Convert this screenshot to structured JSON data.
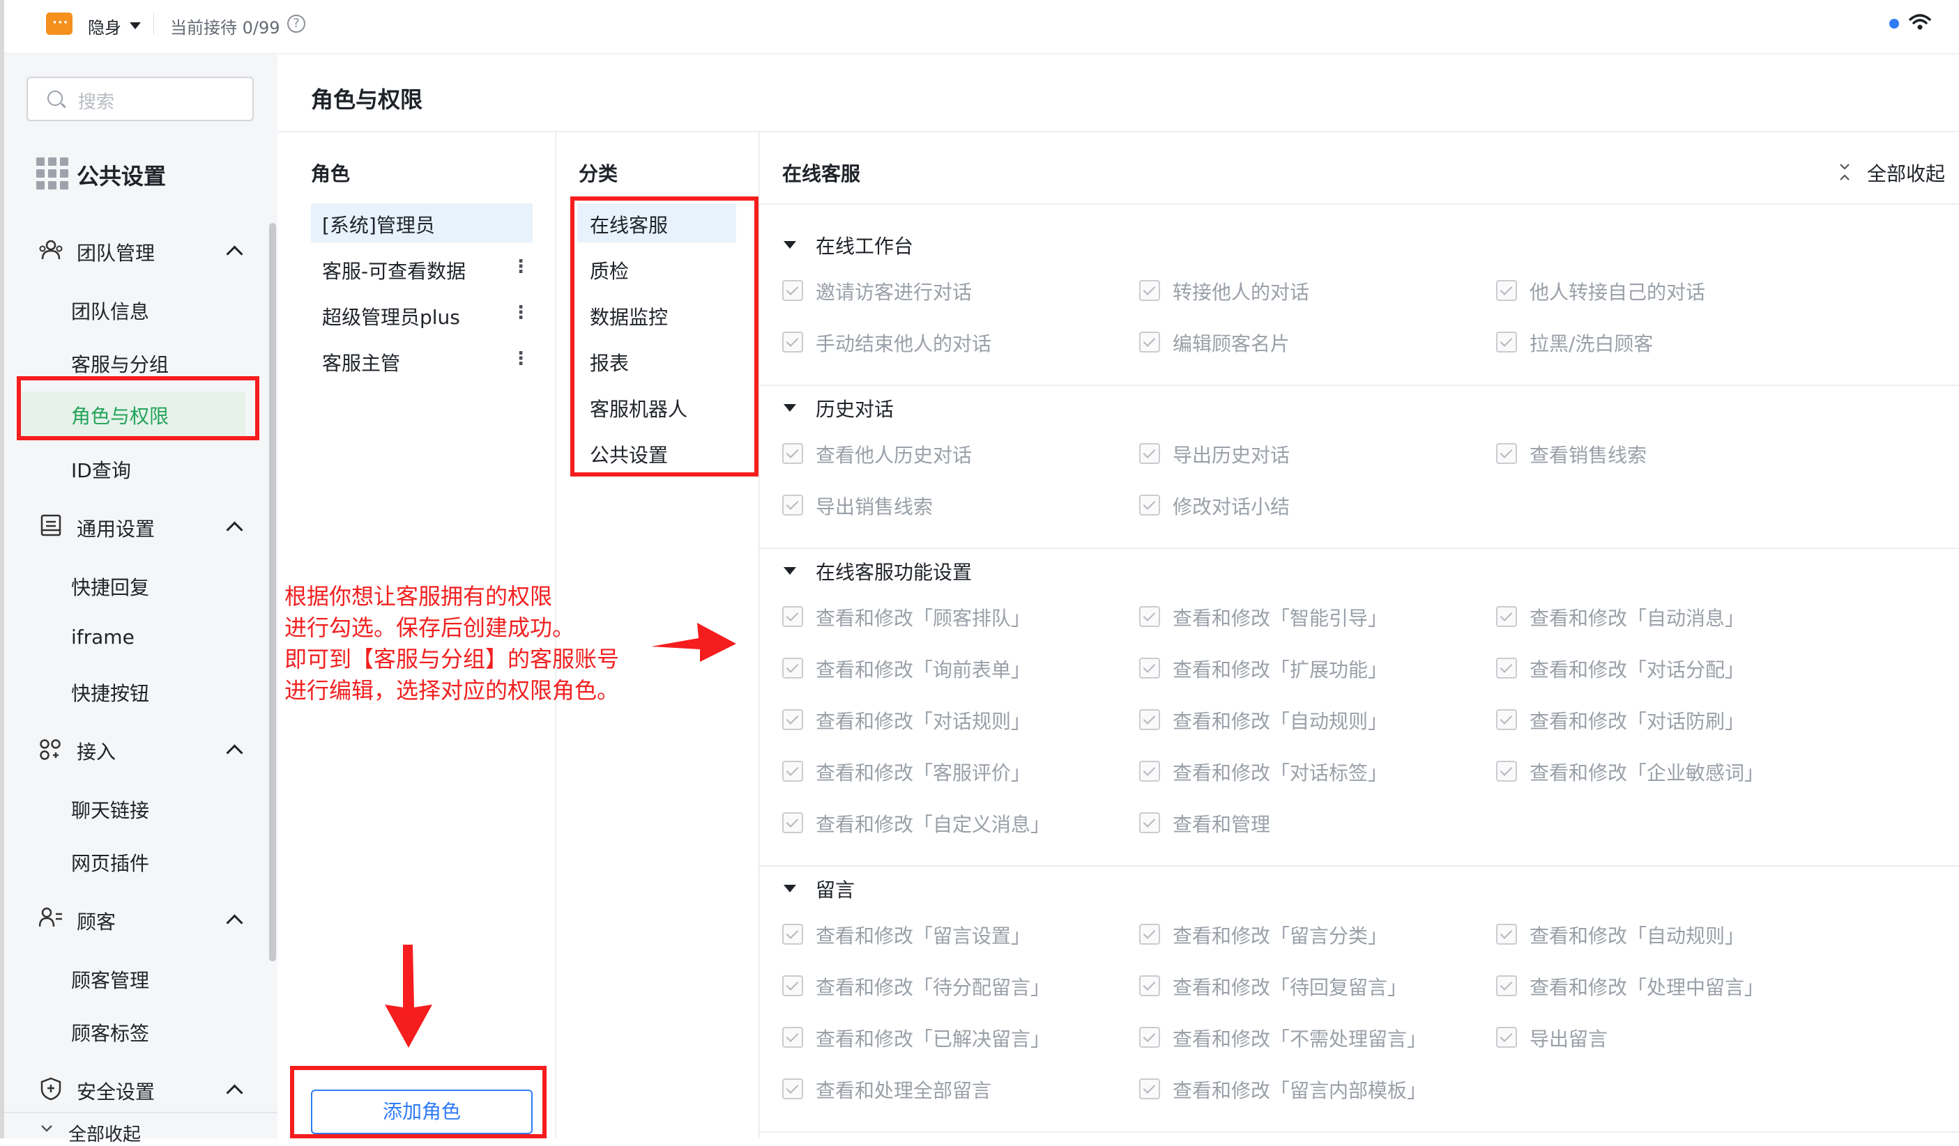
{
  "topbar": {
    "status": "隐身",
    "current_reception": "当前接待 0/99",
    "help": "?"
  },
  "sidebar": {
    "search_placeholder": "搜索",
    "title": "公共设置",
    "groups": [
      {
        "label": "团队管理",
        "icon": "team-icon",
        "items": [
          "团队信息",
          "客服与分组",
          "角色与权限",
          "ID查询"
        ]
      },
      {
        "label": "通用设置",
        "icon": "settings-list-icon",
        "items": [
          "快捷回复",
          "iframe",
          "快捷按钮"
        ]
      },
      {
        "label": "接入",
        "icon": "access-icon",
        "items": [
          "聊天链接",
          "网页插件"
        ]
      },
      {
        "label": "顾客",
        "icon": "customer-icon",
        "items": [
          "顾客管理",
          "顾客标签"
        ]
      },
      {
        "label": "安全设置",
        "icon": "shield-icon",
        "items": []
      }
    ],
    "collapse_all": "全部收起"
  },
  "main": {
    "title": "角色与权限",
    "roles_header": "角色",
    "roles": [
      "[系统]管理员",
      "客服-可查看数据",
      "超级管理员plus",
      "客服主管"
    ],
    "add_role": "添加角色",
    "categories_header": "分类",
    "categories": [
      "在线客服",
      "质检",
      "数据监控",
      "报表",
      "客服机器人",
      "公共设置"
    ],
    "perm_header": "在线客服",
    "collapse_all": "全部收起"
  },
  "annotation": {
    "lines": [
      "根据你想让客服拥有的权限",
      "进行勾选。保存后创建成功。",
      "即可到【客服与分组】的客服账号",
      "进行编辑，选择对应的权限角色。"
    ]
  },
  "permissions": [
    {
      "title": "在线工作台",
      "items": [
        "邀请访客进行对话",
        "转接他人的对话",
        "他人转接自己的对话",
        "手动结束他人的对话",
        "编辑顾客名片",
        "拉黑/洗白顾客"
      ]
    },
    {
      "title": "历史对话",
      "items": [
        "查看他人历史对话",
        "导出历史对话",
        "查看销售线索",
        "导出销售线索",
        "修改对话小结"
      ]
    },
    {
      "title": "在线客服功能设置",
      "items": [
        "查看和修改「顾客排队」",
        "查看和修改「智能引导」",
        "查看和修改「自动消息」",
        "查看和修改「询前表单」",
        "查看和修改「扩展功能」",
        "查看和修改「对话分配」",
        "查看和修改「对话规则」",
        "查看和修改「自动规则」",
        "查看和修改「对话防刷」",
        "查看和修改「客服评价」",
        "查看和修改「对话标签」",
        "查看和修改「企业敏感词」",
        "查看和修改「自定义消息」",
        "查看和管理"
      ]
    },
    {
      "title": "留言",
      "items": [
        "查看和修改「留言设置」",
        "查看和修改「留言分类」",
        "查看和修改「自动规则」",
        "查看和修改「待分配留言」",
        "查看和修改「待回复留言」",
        "查看和修改「处理中留言」",
        "查看和修改「已解决留言」",
        "查看和修改「不需处理留言」",
        "导出留言",
        "查看和处理全部留言",
        "查看和修改「留言内部模板」"
      ]
    }
  ]
}
